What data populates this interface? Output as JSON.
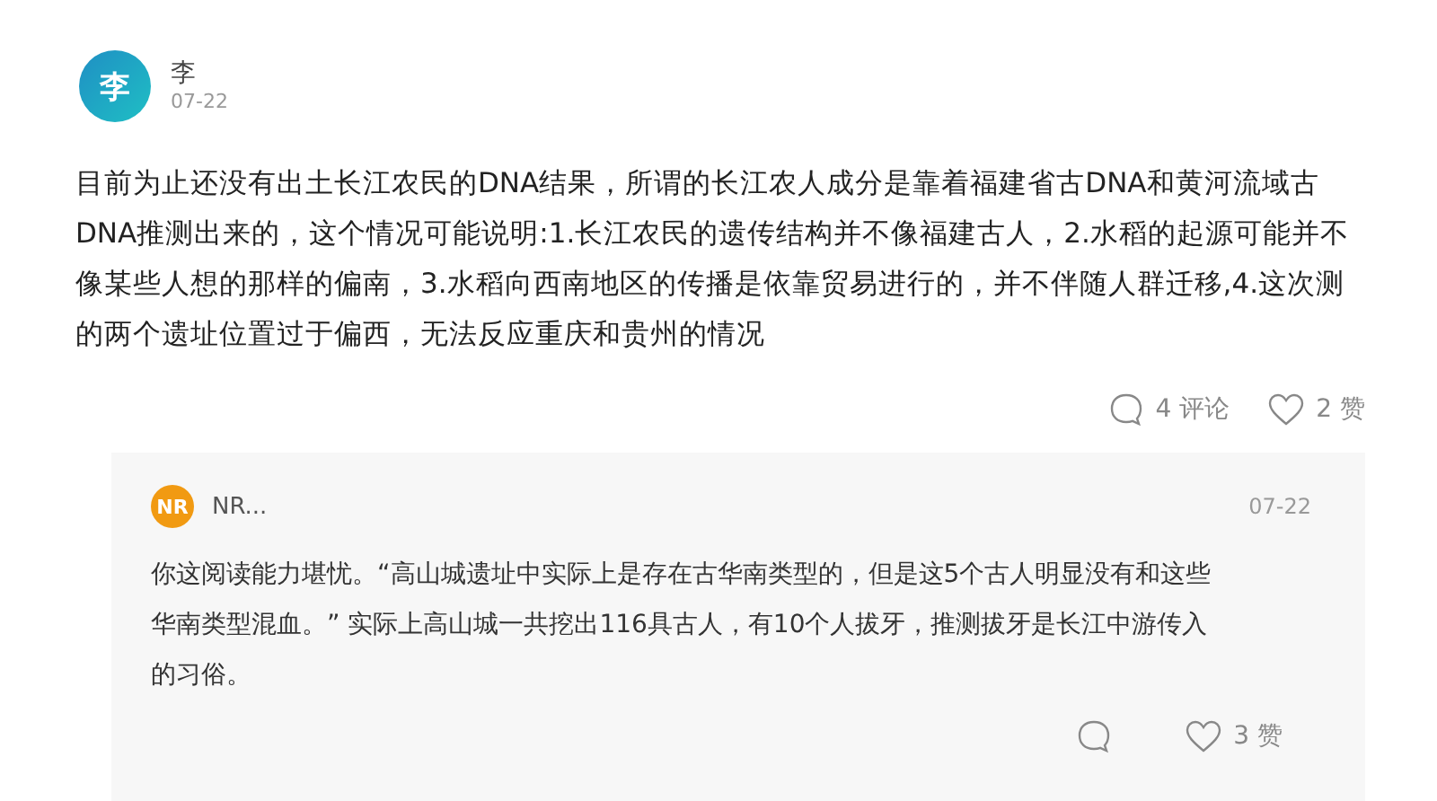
{
  "post": {
    "avatar": "李",
    "author": "李",
    "date": "07-22",
    "text": "目前为止还没有出土长江农民的DNA结果，所谓的长江农人成分是靠着福建省古DNA和黄河流域古DNA推测出来的，这个情况可能说明:1.长江农民的遗传结构并不像福建古人，2.水稻的起源可能并不像某些人想的那样的偏南，3.水稻向西南地区的传播是依靠贸易进行的，并不伴随人群迁移,4.这次测的两个遗址位置过于偏西，无法反应重庆和贵州的情况",
    "comments": "4 评论",
    "likes": "2 赞"
  },
  "reply": {
    "avatar": "NR",
    "author": "NR...",
    "date": "07-22",
    "text": "你这阅读能力堪忧。“高山城遗址中实际上是存在古华南类型的，但是这5个古人明显没有和这些华南类型混血。” 实际上高山城一共挖出116具古人，有10个人拔牙，推测拔牙是长江中游传入的习俗。",
    "likes": "3 赞"
  }
}
